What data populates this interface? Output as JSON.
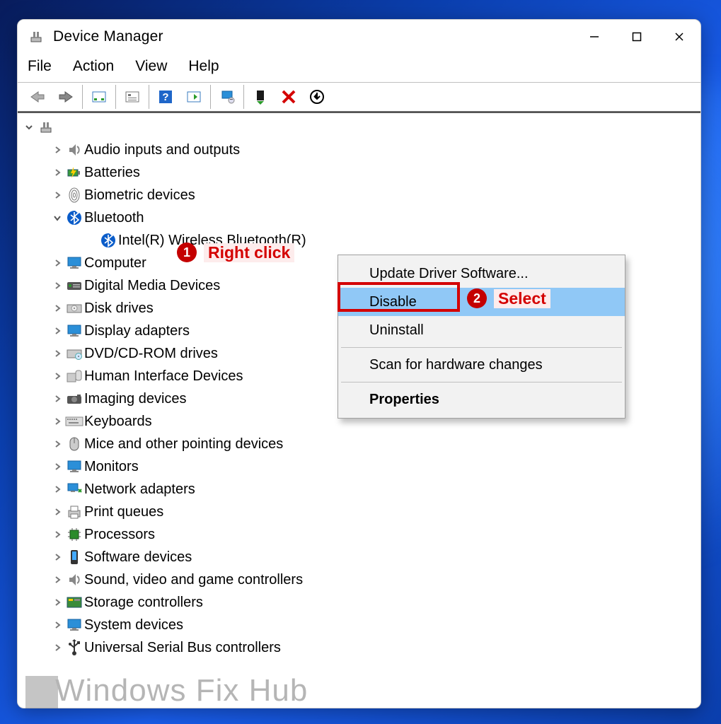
{
  "window": {
    "title": "Device Manager"
  },
  "menu": {
    "file": "File",
    "action": "Action",
    "view": "View",
    "help": "Help"
  },
  "tree": {
    "root_expanded": true,
    "categories": [
      {
        "label": "Audio inputs and outputs",
        "expanded": false
      },
      {
        "label": "Batteries",
        "expanded": false
      },
      {
        "label": "Biometric devices",
        "expanded": false
      },
      {
        "label": "Bluetooth",
        "expanded": true,
        "children": [
          {
            "label": "Intel(R) Wireless Bluetooth(R)"
          }
        ]
      },
      {
        "label": "Computer",
        "expanded": false
      },
      {
        "label": "Digital Media Devices",
        "expanded": false
      },
      {
        "label": "Disk drives",
        "expanded": false
      },
      {
        "label": "Display adapters",
        "expanded": false
      },
      {
        "label": "DVD/CD-ROM drives",
        "expanded": false
      },
      {
        "label": "Human Interface Devices",
        "expanded": false
      },
      {
        "label": "Imaging devices",
        "expanded": false
      },
      {
        "label": "Keyboards",
        "expanded": false
      },
      {
        "label": "Mice and other pointing devices",
        "expanded": false
      },
      {
        "label": "Monitors",
        "expanded": false
      },
      {
        "label": "Network adapters",
        "expanded": false
      },
      {
        "label": "Print queues",
        "expanded": false
      },
      {
        "label": "Processors",
        "expanded": false
      },
      {
        "label": "Software devices",
        "expanded": false
      },
      {
        "label": "Sound, video and game controllers",
        "expanded": false
      },
      {
        "label": "Storage controllers",
        "expanded": false
      },
      {
        "label": "System devices",
        "expanded": false
      },
      {
        "label": "Universal Serial Bus controllers",
        "expanded": false
      }
    ]
  },
  "context_menu": {
    "items": [
      {
        "label": "Update Driver Software..."
      },
      {
        "label": "Disable",
        "highlighted": true
      },
      {
        "label": "Uninstall"
      },
      {
        "separator": true
      },
      {
        "label": "Scan for hardware changes"
      },
      {
        "separator": true
      },
      {
        "label": "Properties",
        "bold": true
      }
    ]
  },
  "annotations": {
    "step1_num": "1",
    "step1_text": "Right click",
    "step2_num": "2",
    "step2_text": "Select"
  },
  "watermark": "Windows Fix Hub"
}
